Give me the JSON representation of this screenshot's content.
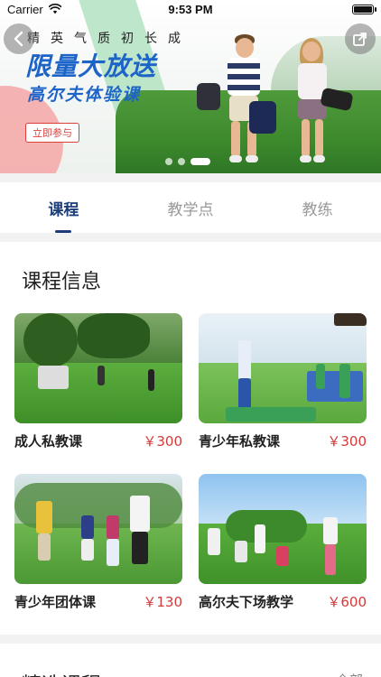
{
  "status_bar": {
    "carrier": "Carrier",
    "time": "9:53 PM"
  },
  "banner": {
    "slogan_top": "精英气质初长成",
    "slogan_big": "限量大放送",
    "slogan_sub": "高尔夫体验课",
    "join_label": "立即参与",
    "carousel_dots": 3,
    "active_dot": 3,
    "brand_color": "#1d64c8",
    "accent_color": "#d9403a"
  },
  "tabs": [
    {
      "label": "课程",
      "active": true
    },
    {
      "label": "教学点",
      "active": false
    },
    {
      "label": "教练",
      "active": false
    }
  ],
  "courses_section": {
    "title": "课程信息",
    "items": [
      {
        "name": "成人私教课",
        "price": "￥300"
      },
      {
        "name": "青少年私教课",
        "price": "￥300"
      },
      {
        "name": "青少年团体课",
        "price": "￥130"
      },
      {
        "name": "高尔夫下场教学",
        "price": "￥600"
      }
    ]
  },
  "next_section": {
    "title": "精选课程",
    "more": "全部"
  },
  "colors": {
    "tab_active": "#1c3d7a",
    "price": "#d33a3a"
  }
}
